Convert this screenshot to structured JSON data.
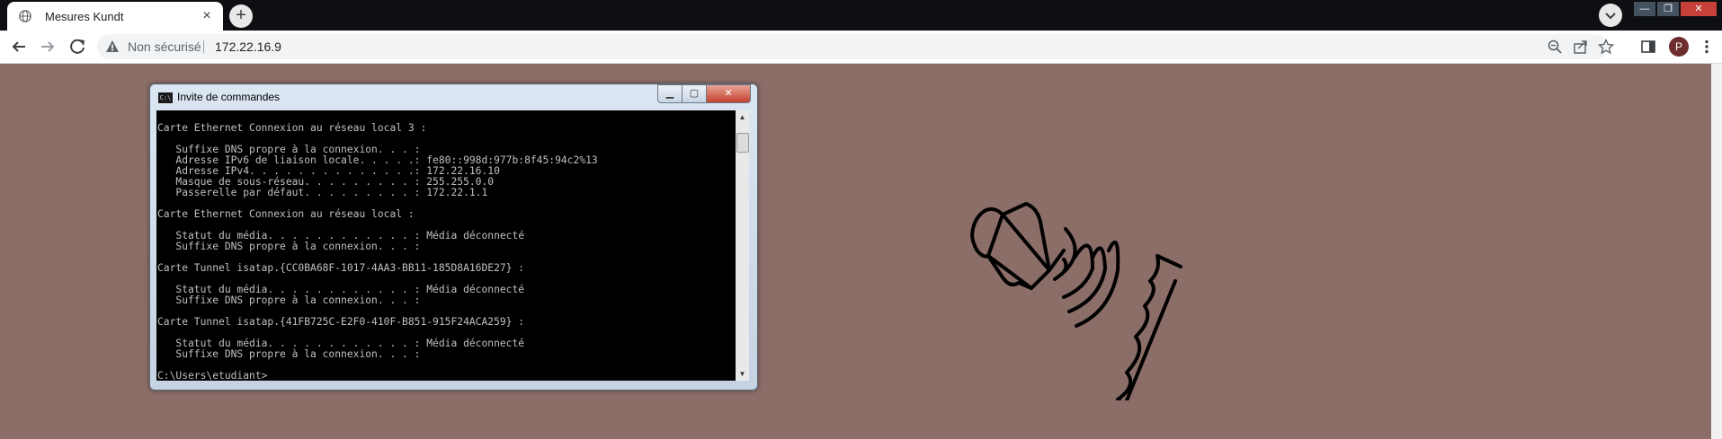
{
  "browser": {
    "tab": {
      "title": "Mesures Kundt",
      "close_label": "×"
    },
    "new_tab_label": "+",
    "window_controls": {
      "minimize": "—",
      "maximize": "❐",
      "close": "✕"
    },
    "security_label": "Non sécurisé",
    "url": "172.22.16.9",
    "profile_initial": "P",
    "icons": [
      "back-icon",
      "forward-icon",
      "reload-icon",
      "info-icon",
      "zoom-icon",
      "share-icon",
      "star-icon",
      "side-panel-icon",
      "menu-icon"
    ]
  },
  "cmd_window": {
    "title": "Invite de commandes",
    "lines": [
      "",
      "Carte Ethernet Connexion au réseau local 3 :",
      "",
      "   Suffixe DNS propre à la connexion. . . :",
      "   Adresse IPv6 de liaison locale. . . . .: fe80::998d:977b:8f45:94c2%13",
      "   Adresse IPv4. . . . . . . . . . . . . .: 172.22.16.10",
      "   Masque de sous-réseau. . . . . . . . . : 255.255.0.0",
      "   Passerelle par défaut. . . . . . . . . : 172.22.1.1",
      "",
      "Carte Ethernet Connexion au réseau local :",
      "",
      "   Statut du média. . . . . . . . . . . . : Média déconnecté",
      "   Suffixe DNS propre à la connexion. . . :",
      "",
      "Carte Tunnel isatap.{CC0BA68F-1017-4AA3-BB11-185D8A16DE27} :",
      "",
      "   Statut du média. . . . . . . . . . . . : Média déconnecté",
      "   Suffixe DNS propre à la connexion. . . :",
      "",
      "Carte Tunnel isatap.{41FB725C-E2F0-410F-B851-915F24ACA259} :",
      "",
      "   Statut du média. . . . . . . . . . . . : Média déconnecté",
      "   Suffixe DNS propre à la connexion. . . :",
      "",
      "C:\\Users\\etudiant>"
    ]
  },
  "page": {
    "background_color": "#8c6e69",
    "logo_icon": "speaker-waves-icon"
  }
}
